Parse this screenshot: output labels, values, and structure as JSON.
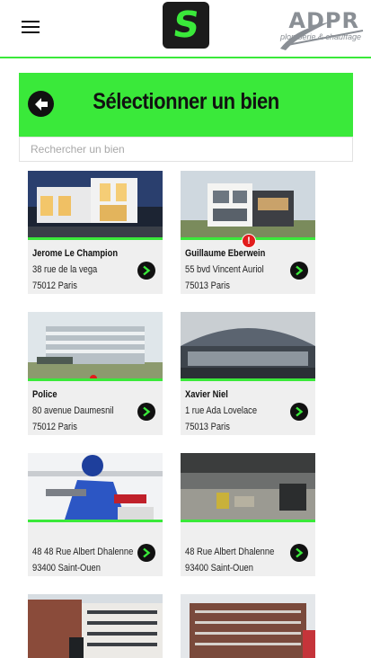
{
  "header": {
    "app_logo_glyph": "S",
    "brand_name": "ADPR",
    "brand_tagline": "plomberie & chauffage"
  },
  "page": {
    "title": "Sélectionner un bien"
  },
  "search": {
    "placeholder": "Rechercher un bien",
    "value": ""
  },
  "colors": {
    "accent": "#3ae93a",
    "alert": "#e21d1d",
    "card_bg": "#efefef"
  },
  "properties": [
    {
      "name": "Jerome Le Champion",
      "street": "38 rue de la vega",
      "city": "75012 Paris",
      "alert": ""
    },
    {
      "name": "Guillaume Eberwein",
      "street": "55 bvd Vincent Auriol",
      "city": "75013 Paris",
      "alert": "!"
    },
    {
      "name": "Police",
      "street": "80 avenue Daumesnil",
      "city": "75012 Paris",
      "alert": ""
    },
    {
      "name": "Xavier Niel",
      "street": "1 rue Ada Lovelace",
      "city": "75013 Paris",
      "alert": ""
    },
    {
      "name": "",
      "street": "48 48 Rue Albert Dhalenne",
      "city": "93400 Saint-Ouen",
      "alert": ""
    },
    {
      "name": "",
      "street": "48 Rue Albert Dhalenne",
      "city": "93400 Saint-Ouen",
      "alert": ""
    }
  ],
  "icons": {
    "menu": "hamburger-menu-icon",
    "back": "back-arrow-icon",
    "card_action": "chevron-right-circle-icon"
  }
}
